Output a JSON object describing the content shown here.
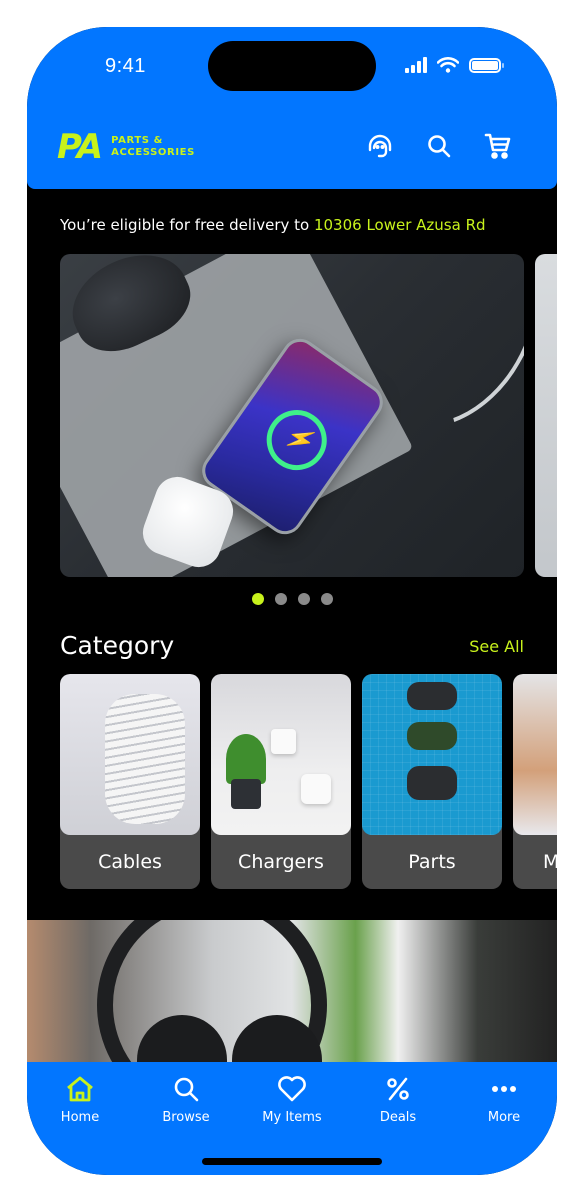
{
  "status_bar": {
    "time": "9:41"
  },
  "header": {
    "logo_mark": "PA",
    "logo_line1": "PARTS &",
    "logo_line2": "ACCESSORIES",
    "icons": [
      "support-headset-icon",
      "search-icon",
      "cart-icon"
    ]
  },
  "delivery": {
    "prefix": "You’re eligible for free delivery to ",
    "address": "10306 Lower Azusa Rd"
  },
  "carousel": {
    "slide_count": 4,
    "active_index": 0
  },
  "category": {
    "title": "Category",
    "see_all": "See All",
    "items": [
      {
        "label": "Cables"
      },
      {
        "label": "Chargers"
      },
      {
        "label": "Parts"
      },
      {
        "label": "M"
      }
    ]
  },
  "bottom_nav": {
    "items": [
      {
        "label": "Home",
        "icon": "home-icon",
        "active": true
      },
      {
        "label": "Browse",
        "icon": "search-icon",
        "active": false
      },
      {
        "label": "My Items",
        "icon": "heart-icon",
        "active": false
      },
      {
        "label": "Deals",
        "icon": "percent-icon",
        "active": false
      },
      {
        "label": "More",
        "icon": "more-dots-icon",
        "active": false
      }
    ]
  },
  "colors": {
    "brand_blue": "#0276FF",
    "accent_lime": "#C8F21C",
    "background": "#000000",
    "card_gray": "#4A4A4A"
  }
}
